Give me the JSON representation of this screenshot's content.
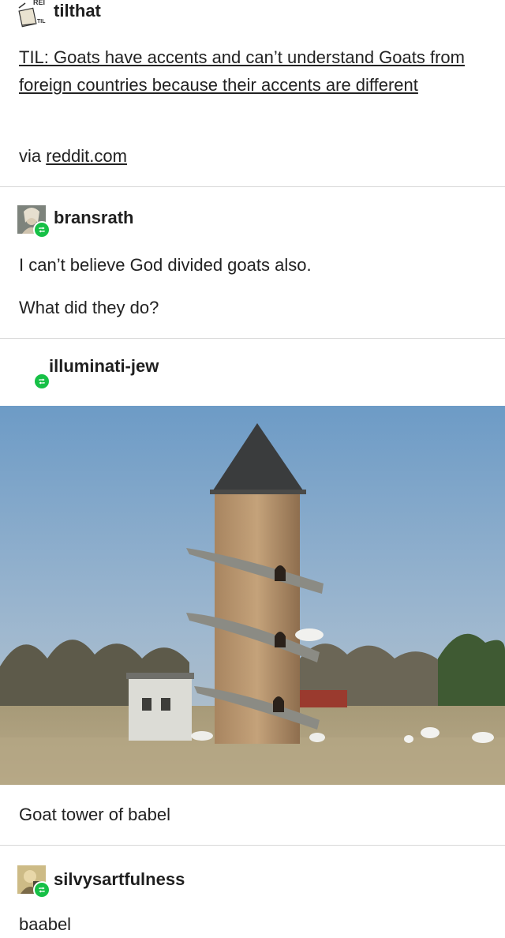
{
  "posts": [
    {
      "username": "tilthat",
      "title_link": "TIL: Goats have accents and can’t understand Goats from foreign countries because their accents are different",
      "via_prefix": "via",
      "via_link": "reddit.com"
    },
    {
      "username": "bransrath",
      "paragraphs": [
        "I can’t believe God divided goats also.",
        "What did they do?"
      ]
    },
    {
      "username": "illuminati-jew",
      "caption": "Goat tower of babel"
    },
    {
      "username": "silvysartfulness",
      "text": "baabel"
    }
  ],
  "avatar_labels": {
    "tilthat_top": "REI",
    "tilthat_side": "TIL"
  },
  "colors": {
    "reblog_badge": "#16c046",
    "divider": "#d8d8d8",
    "text": "#222222"
  },
  "icons": {
    "reblog": "reblog-icon"
  }
}
